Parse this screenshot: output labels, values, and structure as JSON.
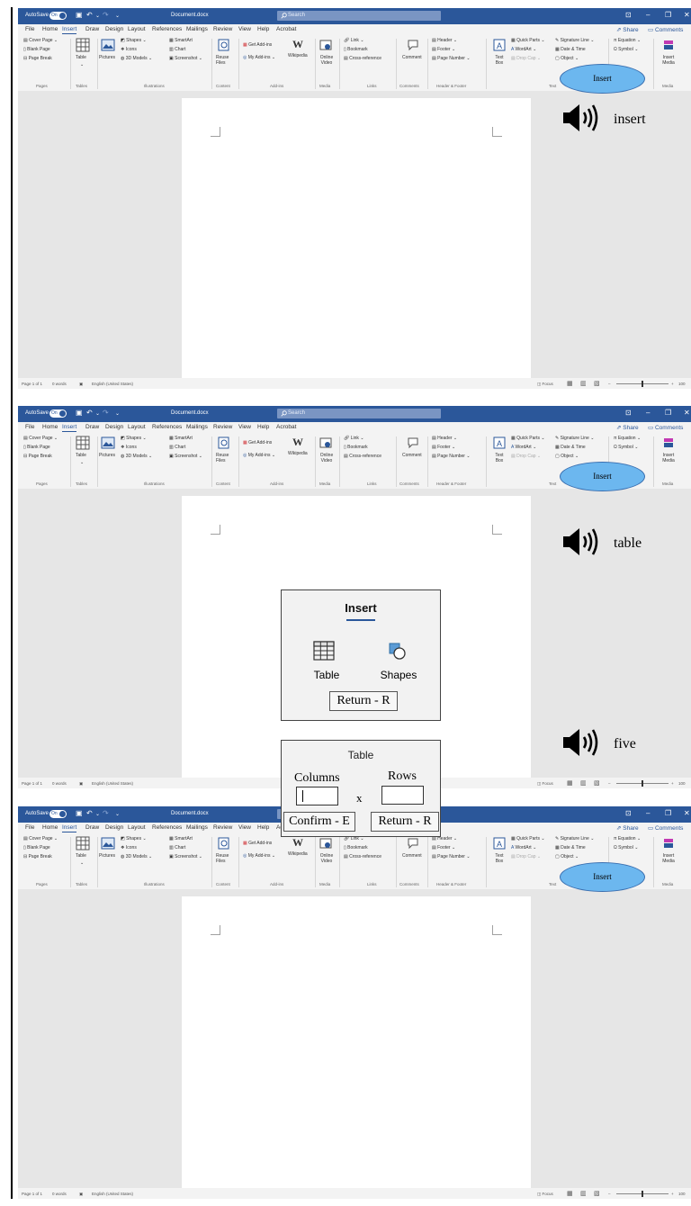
{
  "window": {
    "autosave": "AutoSave",
    "toggle_state": "On",
    "doc_name": "Document.docx",
    "search_placeholder": "Search"
  },
  "menu": {
    "tabs": [
      "File",
      "Home",
      "Insert",
      "Draw",
      "Design",
      "Layout",
      "References",
      "Mailings",
      "Review",
      "View",
      "Help",
      "Acrobat"
    ],
    "active_tab": "Insert",
    "share": "Share",
    "comments": "Comments"
  },
  "ribbon": {
    "cover_page": "Cover Page",
    "blank_page": "Blank Page",
    "page_break": "Page Break",
    "group_pages": "Pages",
    "table": "Table",
    "group_tables": "Tables",
    "pictures": "Pictures",
    "shapes": "Shapes",
    "icons": "Icons",
    "models_3d": "3D Models",
    "smartart": "SmartArt",
    "chart": "Chart",
    "screenshot": "Screenshot",
    "group_illustrations": "Illustrations",
    "reuse_files": "Reuse Files",
    "group_content": "Content",
    "get_addins": "Get Add-ins",
    "my_addins": "My Add-ins",
    "wikipedia": "Wikipedia",
    "group_addins": "Add-ins",
    "online_video": "Online Video",
    "group_media": "Media",
    "link": "Link",
    "bookmark": "Bookmark",
    "cross_reference": "Cross-reference",
    "group_links": "Links",
    "comment": "Comment",
    "group_comments": "Comments",
    "header": "Header",
    "footer": "Footer",
    "page_number": "Page Number",
    "group_header_footer": "Header & Footer",
    "text_box": "Text Box",
    "quick_parts": "Quick Parts",
    "wordart": "WordArt",
    "drop_cap": "Drop Cap",
    "signature_line": "Signature Line",
    "date_time": "Date & Time",
    "object": "Object",
    "group_text": "Text",
    "equation": "Equation",
    "symbol": "Symbol",
    "insert_media": "Insert Media",
    "group_media2": "Media"
  },
  "status": {
    "page": "Page 1 of 1",
    "words": "0 words",
    "language": "English (United States)",
    "focus": "Focus",
    "zoom": "100"
  },
  "highlight_label": "Insert",
  "panels": [
    {
      "spoken_word": "insert"
    },
    {
      "spoken_word": "table"
    },
    {
      "spoken_word": "five"
    }
  ],
  "insert_popup": {
    "title": "Insert",
    "table": "Table",
    "shapes": "Shapes",
    "return": "Return - R"
  },
  "table_popup": {
    "title": "Table",
    "columns": "Columns",
    "rows": "Rows",
    "times": "x",
    "confirm": "Confirm - E",
    "return": "Return - R"
  },
  "colors": {
    "titlebar": "#2b579a",
    "accent": "#2b579a",
    "highlight": "#6cb7ef"
  }
}
